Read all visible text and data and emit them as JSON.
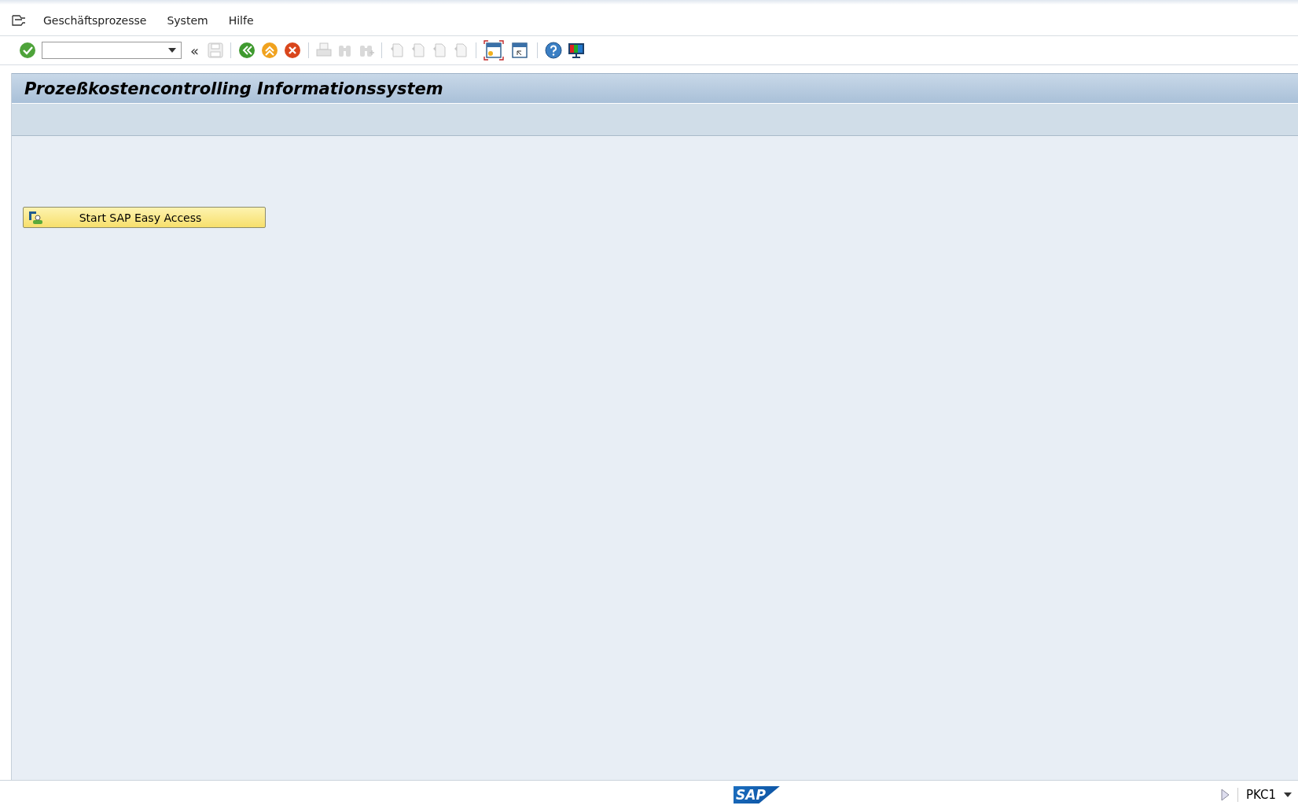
{
  "menu": [
    {
      "label": "Geschäftsprozesse"
    },
    {
      "label": "System"
    },
    {
      "label": "Hilfe"
    }
  ],
  "toolbar": [
    {
      "kind": "enter",
      "disabled": false
    },
    {
      "kind": "command"
    },
    {
      "kind": "collapse",
      "label": "«"
    },
    {
      "kind": "save",
      "disabled": true
    },
    {
      "kind": "sep"
    },
    {
      "kind": "back",
      "disabled": false
    },
    {
      "kind": "exit",
      "disabled": false
    },
    {
      "kind": "cancel",
      "disabled": false
    },
    {
      "kind": "sep"
    },
    {
      "kind": "print",
      "disabled": true
    },
    {
      "kind": "find",
      "disabled": true
    },
    {
      "kind": "findnext",
      "disabled": true
    },
    {
      "kind": "sep"
    },
    {
      "kind": "page",
      "disabled": true
    },
    {
      "kind": "page",
      "disabled": true
    },
    {
      "kind": "page",
      "disabled": true
    },
    {
      "kind": "page",
      "disabled": true
    },
    {
      "kind": "sep"
    },
    {
      "kind": "session",
      "selected": true
    },
    {
      "kind": "shortcut",
      "selected": false
    },
    {
      "kind": "sep"
    },
    {
      "kind": "help",
      "disabled": false
    },
    {
      "kind": "layout",
      "disabled": false
    }
  ],
  "title": "Prozeßkostencontrolling Informationssystem",
  "start_button": {
    "label": "Start SAP Easy Access"
  },
  "status_bar": {
    "logo": "SAP",
    "transaction": "PKC1"
  }
}
